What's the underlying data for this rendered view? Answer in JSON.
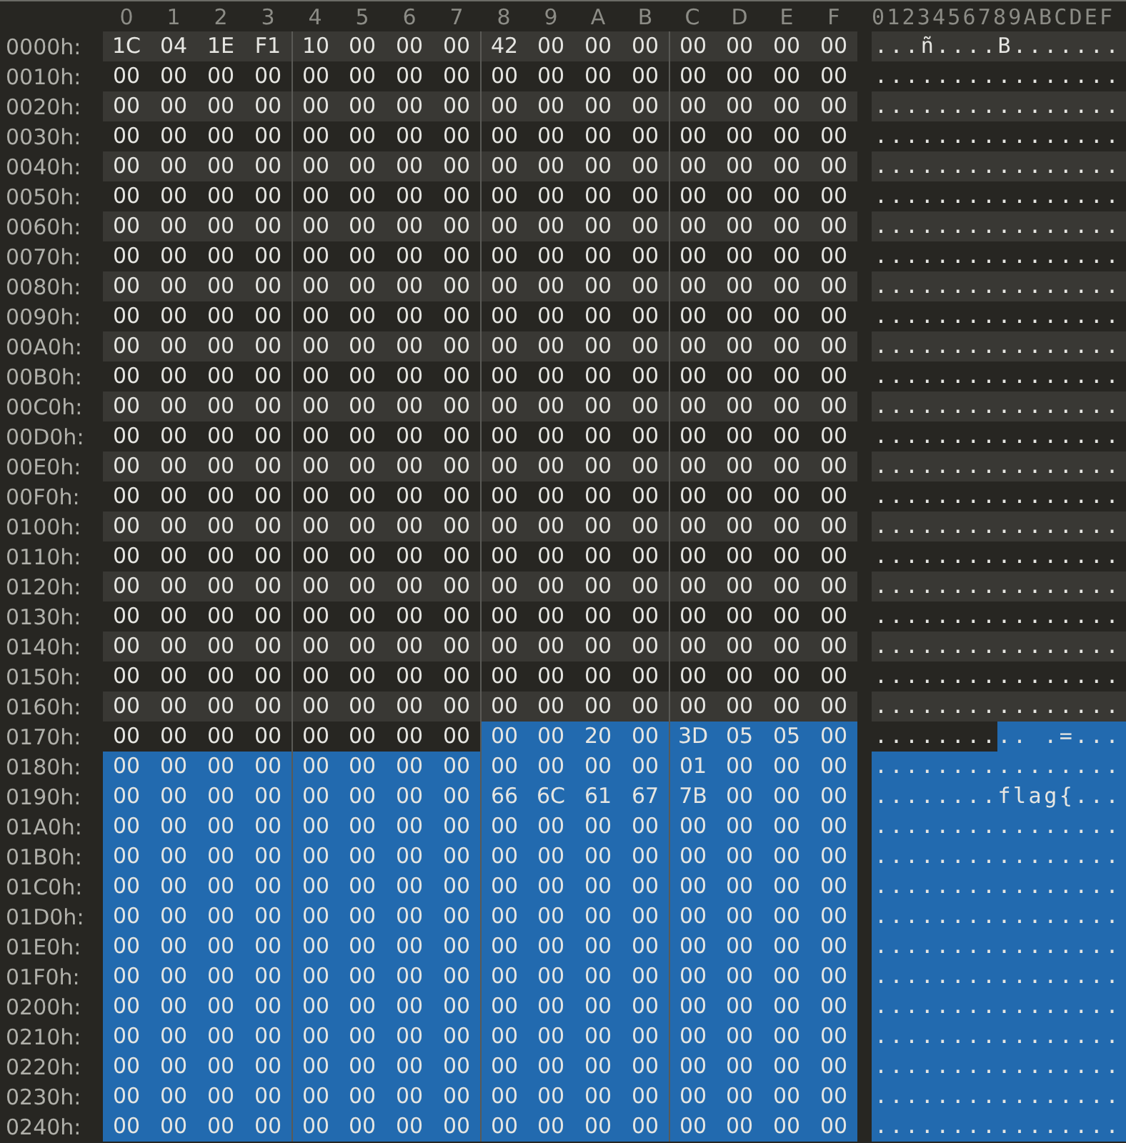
{
  "header": {
    "columns": [
      "0",
      "1",
      "2",
      "3",
      "4",
      "5",
      "6",
      "7",
      "8",
      "9",
      "A",
      "B",
      "C",
      "D",
      "E",
      "F"
    ],
    "ascii_label": "0123456789ABCDEF"
  },
  "rows": [
    {
      "offset": "0000h:",
      "segments": [
        {
          "selected": false,
          "bytes": [
            "1C",
            "04",
            "1E",
            "F1",
            "10",
            "00",
            "00",
            "00",
            "42",
            "00",
            "00",
            "00",
            "00",
            "00",
            "00",
            "00"
          ],
          "ascii": "...ñ....B......."
        }
      ]
    },
    {
      "offset": "0010h:",
      "segments": [
        {
          "selected": false,
          "bytes": [
            "00",
            "00",
            "00",
            "00",
            "00",
            "00",
            "00",
            "00",
            "00",
            "00",
            "00",
            "00",
            "00",
            "00",
            "00",
            "00"
          ],
          "ascii": "................"
        }
      ]
    },
    {
      "offset": "0020h:",
      "segments": [
        {
          "selected": false,
          "bytes": [
            "00",
            "00",
            "00",
            "00",
            "00",
            "00",
            "00",
            "00",
            "00",
            "00",
            "00",
            "00",
            "00",
            "00",
            "00",
            "00"
          ],
          "ascii": "................"
        }
      ]
    },
    {
      "offset": "0030h:",
      "segments": [
        {
          "selected": false,
          "bytes": [
            "00",
            "00",
            "00",
            "00",
            "00",
            "00",
            "00",
            "00",
            "00",
            "00",
            "00",
            "00",
            "00",
            "00",
            "00",
            "00"
          ],
          "ascii": "................"
        }
      ]
    },
    {
      "offset": "0040h:",
      "segments": [
        {
          "selected": false,
          "bytes": [
            "00",
            "00",
            "00",
            "00",
            "00",
            "00",
            "00",
            "00",
            "00",
            "00",
            "00",
            "00",
            "00",
            "00",
            "00",
            "00"
          ],
          "ascii": "................"
        }
      ]
    },
    {
      "offset": "0050h:",
      "segments": [
        {
          "selected": false,
          "bytes": [
            "00",
            "00",
            "00",
            "00",
            "00",
            "00",
            "00",
            "00",
            "00",
            "00",
            "00",
            "00",
            "00",
            "00",
            "00",
            "00"
          ],
          "ascii": "................"
        }
      ]
    },
    {
      "offset": "0060h:",
      "segments": [
        {
          "selected": false,
          "bytes": [
            "00",
            "00",
            "00",
            "00",
            "00",
            "00",
            "00",
            "00",
            "00",
            "00",
            "00",
            "00",
            "00",
            "00",
            "00",
            "00"
          ],
          "ascii": "................"
        }
      ]
    },
    {
      "offset": "0070h:",
      "segments": [
        {
          "selected": false,
          "bytes": [
            "00",
            "00",
            "00",
            "00",
            "00",
            "00",
            "00",
            "00",
            "00",
            "00",
            "00",
            "00",
            "00",
            "00",
            "00",
            "00"
          ],
          "ascii": "................"
        }
      ]
    },
    {
      "offset": "0080h:",
      "segments": [
        {
          "selected": false,
          "bytes": [
            "00",
            "00",
            "00",
            "00",
            "00",
            "00",
            "00",
            "00",
            "00",
            "00",
            "00",
            "00",
            "00",
            "00",
            "00",
            "00"
          ],
          "ascii": "................"
        }
      ]
    },
    {
      "offset": "0090h:",
      "segments": [
        {
          "selected": false,
          "bytes": [
            "00",
            "00",
            "00",
            "00",
            "00",
            "00",
            "00",
            "00",
            "00",
            "00",
            "00",
            "00",
            "00",
            "00",
            "00",
            "00"
          ],
          "ascii": "................"
        }
      ]
    },
    {
      "offset": "00A0h:",
      "segments": [
        {
          "selected": false,
          "bytes": [
            "00",
            "00",
            "00",
            "00",
            "00",
            "00",
            "00",
            "00",
            "00",
            "00",
            "00",
            "00",
            "00",
            "00",
            "00",
            "00"
          ],
          "ascii": "................"
        }
      ]
    },
    {
      "offset": "00B0h:",
      "segments": [
        {
          "selected": false,
          "bytes": [
            "00",
            "00",
            "00",
            "00",
            "00",
            "00",
            "00",
            "00",
            "00",
            "00",
            "00",
            "00",
            "00",
            "00",
            "00",
            "00"
          ],
          "ascii": "................"
        }
      ]
    },
    {
      "offset": "00C0h:",
      "segments": [
        {
          "selected": false,
          "bytes": [
            "00",
            "00",
            "00",
            "00",
            "00",
            "00",
            "00",
            "00",
            "00",
            "00",
            "00",
            "00",
            "00",
            "00",
            "00",
            "00"
          ],
          "ascii": "................"
        }
      ]
    },
    {
      "offset": "00D0h:",
      "segments": [
        {
          "selected": false,
          "bytes": [
            "00",
            "00",
            "00",
            "00",
            "00",
            "00",
            "00",
            "00",
            "00",
            "00",
            "00",
            "00",
            "00",
            "00",
            "00",
            "00"
          ],
          "ascii": "................"
        }
      ]
    },
    {
      "offset": "00E0h:",
      "segments": [
        {
          "selected": false,
          "bytes": [
            "00",
            "00",
            "00",
            "00",
            "00",
            "00",
            "00",
            "00",
            "00",
            "00",
            "00",
            "00",
            "00",
            "00",
            "00",
            "00"
          ],
          "ascii": "................"
        }
      ]
    },
    {
      "offset": "00F0h:",
      "segments": [
        {
          "selected": false,
          "bytes": [
            "00",
            "00",
            "00",
            "00",
            "00",
            "00",
            "00",
            "00",
            "00",
            "00",
            "00",
            "00",
            "00",
            "00",
            "00",
            "00"
          ],
          "ascii": "................"
        }
      ]
    },
    {
      "offset": "0100h:",
      "segments": [
        {
          "selected": false,
          "bytes": [
            "00",
            "00",
            "00",
            "00",
            "00",
            "00",
            "00",
            "00",
            "00",
            "00",
            "00",
            "00",
            "00",
            "00",
            "00",
            "00"
          ],
          "ascii": "................"
        }
      ]
    },
    {
      "offset": "0110h:",
      "segments": [
        {
          "selected": false,
          "bytes": [
            "00",
            "00",
            "00",
            "00",
            "00",
            "00",
            "00",
            "00",
            "00",
            "00",
            "00",
            "00",
            "00",
            "00",
            "00",
            "00"
          ],
          "ascii": "................"
        }
      ]
    },
    {
      "offset": "0120h:",
      "segments": [
        {
          "selected": false,
          "bytes": [
            "00",
            "00",
            "00",
            "00",
            "00",
            "00",
            "00",
            "00",
            "00",
            "00",
            "00",
            "00",
            "00",
            "00",
            "00",
            "00"
          ],
          "ascii": "................"
        }
      ]
    },
    {
      "offset": "0130h:",
      "segments": [
        {
          "selected": false,
          "bytes": [
            "00",
            "00",
            "00",
            "00",
            "00",
            "00",
            "00",
            "00",
            "00",
            "00",
            "00",
            "00",
            "00",
            "00",
            "00",
            "00"
          ],
          "ascii": "................"
        }
      ]
    },
    {
      "offset": "0140h:",
      "segments": [
        {
          "selected": false,
          "bytes": [
            "00",
            "00",
            "00",
            "00",
            "00",
            "00",
            "00",
            "00",
            "00",
            "00",
            "00",
            "00",
            "00",
            "00",
            "00",
            "00"
          ],
          "ascii": "................"
        }
      ]
    },
    {
      "offset": "0150h:",
      "segments": [
        {
          "selected": false,
          "bytes": [
            "00",
            "00",
            "00",
            "00",
            "00",
            "00",
            "00",
            "00",
            "00",
            "00",
            "00",
            "00",
            "00",
            "00",
            "00",
            "00"
          ],
          "ascii": "................"
        }
      ]
    },
    {
      "offset": "0160h:",
      "segments": [
        {
          "selected": false,
          "bytes": [
            "00",
            "00",
            "00",
            "00",
            "00",
            "00",
            "00",
            "00",
            "00",
            "00",
            "00",
            "00",
            "00",
            "00",
            "00",
            "00"
          ],
          "ascii": "................"
        }
      ]
    },
    {
      "offset": "0170h:",
      "segments": [
        {
          "selected": false,
          "bytes": [
            "00",
            "00",
            "00",
            "00",
            "00",
            "00",
            "00",
            "00"
          ],
          "ascii": "........"
        },
        {
          "selected": true,
          "bytes": [
            "00",
            "00",
            "20",
            "00",
            "3D",
            "05",
            "05",
            "00"
          ],
          "ascii": ".. .=..."
        }
      ]
    },
    {
      "offset": "0180h:",
      "segments": [
        {
          "selected": true,
          "bytes": [
            "00",
            "00",
            "00",
            "00",
            "00",
            "00",
            "00",
            "00",
            "00",
            "00",
            "00",
            "00",
            "01",
            "00",
            "00",
            "00"
          ],
          "ascii": "................"
        }
      ]
    },
    {
      "offset": "0190h:",
      "segments": [
        {
          "selected": true,
          "bytes": [
            "00",
            "00",
            "00",
            "00",
            "00",
            "00",
            "00",
            "00",
            "66",
            "6C",
            "61",
            "67",
            "7B",
            "00",
            "00",
            "00"
          ],
          "ascii": "........flag{..."
        }
      ]
    },
    {
      "offset": "01A0h:",
      "segments": [
        {
          "selected": true,
          "bytes": [
            "00",
            "00",
            "00",
            "00",
            "00",
            "00",
            "00",
            "00",
            "00",
            "00",
            "00",
            "00",
            "00",
            "00",
            "00",
            "00"
          ],
          "ascii": "................"
        }
      ]
    },
    {
      "offset": "01B0h:",
      "segments": [
        {
          "selected": true,
          "bytes": [
            "00",
            "00",
            "00",
            "00",
            "00",
            "00",
            "00",
            "00",
            "00",
            "00",
            "00",
            "00",
            "00",
            "00",
            "00",
            "00"
          ],
          "ascii": "................"
        }
      ]
    },
    {
      "offset": "01C0h:",
      "segments": [
        {
          "selected": true,
          "bytes": [
            "00",
            "00",
            "00",
            "00",
            "00",
            "00",
            "00",
            "00",
            "00",
            "00",
            "00",
            "00",
            "00",
            "00",
            "00",
            "00"
          ],
          "ascii": "................"
        }
      ]
    },
    {
      "offset": "01D0h:",
      "segments": [
        {
          "selected": true,
          "bytes": [
            "00",
            "00",
            "00",
            "00",
            "00",
            "00",
            "00",
            "00",
            "00",
            "00",
            "00",
            "00",
            "00",
            "00",
            "00",
            "00"
          ],
          "ascii": "................"
        }
      ]
    },
    {
      "offset": "01E0h:",
      "segments": [
        {
          "selected": true,
          "bytes": [
            "00",
            "00",
            "00",
            "00",
            "00",
            "00",
            "00",
            "00",
            "00",
            "00",
            "00",
            "00",
            "00",
            "00",
            "00",
            "00"
          ],
          "ascii": "................"
        }
      ]
    },
    {
      "offset": "01F0h:",
      "segments": [
        {
          "selected": true,
          "bytes": [
            "00",
            "00",
            "00",
            "00",
            "00",
            "00",
            "00",
            "00",
            "00",
            "00",
            "00",
            "00",
            "00",
            "00",
            "00",
            "00"
          ],
          "ascii": "................"
        }
      ]
    },
    {
      "offset": "0200h:",
      "segments": [
        {
          "selected": true,
          "bytes": [
            "00",
            "00",
            "00",
            "00",
            "00",
            "00",
            "00",
            "00",
            "00",
            "00",
            "00",
            "00",
            "00",
            "00",
            "00",
            "00"
          ],
          "ascii": "................"
        }
      ]
    },
    {
      "offset": "0210h:",
      "segments": [
        {
          "selected": true,
          "bytes": [
            "00",
            "00",
            "00",
            "00",
            "00",
            "00",
            "00",
            "00",
            "00",
            "00",
            "00",
            "00",
            "00",
            "00",
            "00",
            "00"
          ],
          "ascii": "................"
        }
      ]
    },
    {
      "offset": "0220h:",
      "segments": [
        {
          "selected": true,
          "bytes": [
            "00",
            "00",
            "00",
            "00",
            "00",
            "00",
            "00",
            "00",
            "00",
            "00",
            "00",
            "00",
            "00",
            "00",
            "00",
            "00"
          ],
          "ascii": "................"
        }
      ]
    },
    {
      "offset": "0230h:",
      "segments": [
        {
          "selected": true,
          "bytes": [
            "00",
            "00",
            "00",
            "00",
            "00",
            "00",
            "00",
            "00",
            "00",
            "00",
            "00",
            "00",
            "00",
            "00",
            "00",
            "00"
          ],
          "ascii": "................"
        }
      ]
    },
    {
      "offset": "0240h:",
      "segments": [
        {
          "selected": true,
          "bytes": [
            "00",
            "00",
            "00",
            "00",
            "00",
            "00",
            "00",
            "00",
            "00",
            "00",
            "00",
            "00",
            "00",
            "00",
            "00",
            "00"
          ],
          "ascii": "................"
        }
      ]
    }
  ]
}
